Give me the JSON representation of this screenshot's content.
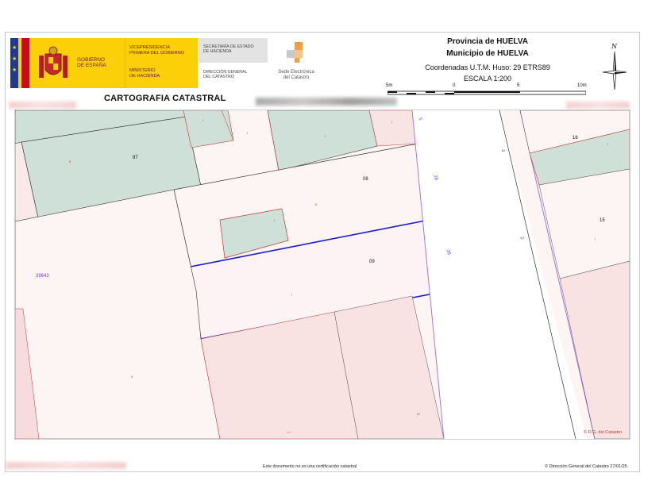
{
  "header": {
    "gobierno_line1": "GOBIERNO",
    "gobierno_line2": "DE ESPAÑA",
    "vicepresidencia_line1": "VICEPRESIDENCIA",
    "vicepresidencia_line2": "PRIMERA DEL GOBIERNO",
    "ministerio_line1": "MINISTERIO",
    "ministerio_line2": "DE HACIENDA",
    "secretaria_line1": "SECRETARÍA DE ESTADO",
    "secretaria_line2": "DE HACIENDA",
    "direccion_line1": "DIRECCIÓN GENERAL",
    "direccion_line2": "DEL CATASTRO",
    "sede_line1": "Sede Electrónica",
    "sede_line2": "del Catastro",
    "provincia": "Provincia de HUELVA",
    "municipio": "Municipio de HUELVA",
    "coordenadas": "Coordenadas U.T.M. Huso: 29 ETRS89",
    "escala": "ESCALA 1:200",
    "scale_labels": [
      "5m",
      "0",
      "5",
      "10m"
    ],
    "title": "CARTOGRAFIA CATASTRAL"
  },
  "map": {
    "labels": {
      "p87": "87",
      "p08": "08",
      "p09": "09",
      "p16": "16",
      "p15": "15",
      "block": "39643",
      "street_28a": "28",
      "street_28b": "28",
      "street_4": "4",
      "street_2": "2",
      "street_5": "5",
      "copyright_small": "© D.G. del Catastro"
    },
    "sub_labels": [
      "II",
      "I",
      "I",
      "I",
      "I",
      "II",
      "I",
      "I",
      "II",
      "I",
      "IV",
      "-I-I",
      "I"
    ]
  },
  "footer": {
    "disclaimer": "Este documento no es una certificación catastral",
    "copyright": "© Dirección General del Catastro 27/01/25"
  },
  "colors": {
    "parcel_fill": "#fdf4f4",
    "building_pink": "#f8e2e2",
    "patio_green": "#cfe0d8",
    "highlight_blue": "#1a1ad0",
    "street_line": "#9b6ce0",
    "logo_yellow": "#fbd008"
  }
}
